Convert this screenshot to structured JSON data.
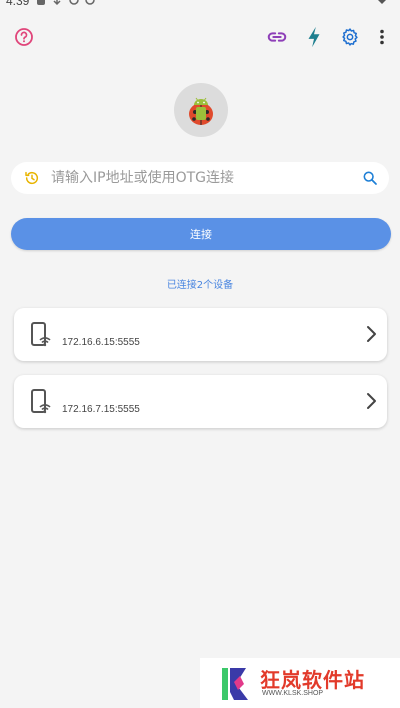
{
  "status_bar": {
    "time": "4:39"
  },
  "toolbar": {
    "help_icon": "help-circle-icon",
    "link_icon": "link-icon",
    "flash_icon": "flash-icon",
    "settings_icon": "gear-icon",
    "more_icon": "more-vert-icon"
  },
  "search": {
    "placeholder": "请输入IP地址或使用OTG连接",
    "value": ""
  },
  "connect_button": {
    "label": "连接"
  },
  "connected_status": "已连接2个设备",
  "devices": [
    {
      "address": "172.16.6.15:5555"
    },
    {
      "address": "172.16.7.15:5555"
    }
  ],
  "watermark": {
    "title": "狂岚软件站",
    "url": "WWW.KLSK.SHOP"
  },
  "colors": {
    "accent": "#5a91e6",
    "link_text": "#4a86e0",
    "help_icon": "#e0457a",
    "link_icon": "#8e3fb8",
    "flash_icon": "#1e7f8f",
    "settings_icon": "#1e6fd0",
    "history_icon": "#e8b400"
  }
}
